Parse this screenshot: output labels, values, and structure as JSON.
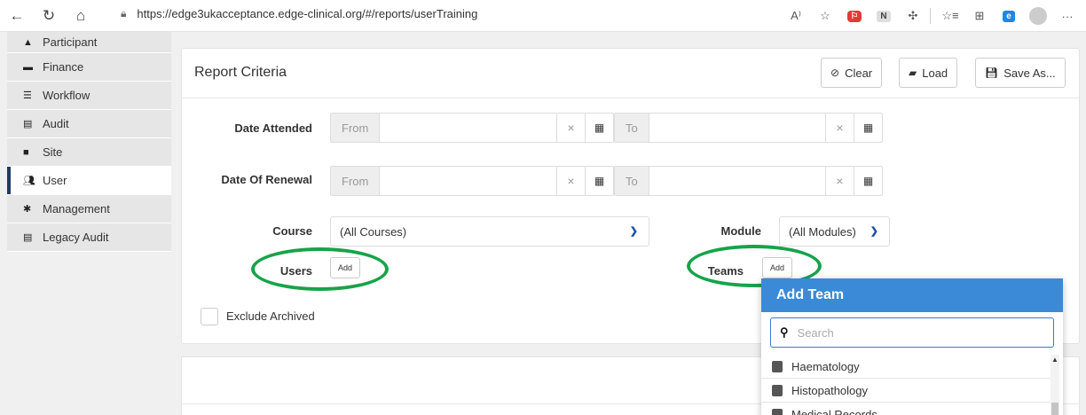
{
  "browser": {
    "url": "https://edge3ukacceptance.edge-clinical.org/#/reports/userTraining",
    "icons": [
      "back-icon",
      "refresh-icon",
      "home-icon",
      "lock-icon",
      "read-aloud-icon",
      "favorite-icon",
      "extension-red-icon",
      "extension-n-icon",
      "extensions-icon",
      "favorites-icon",
      "collections-icon",
      "edge-icon",
      "profile-icon",
      "more-icon"
    ],
    "badge_n": "N",
    "more": "···"
  },
  "sidebar": {
    "items": [
      {
        "label": "Participant",
        "icon": "person-icon"
      },
      {
        "label": "Finance",
        "icon": "wallet-icon"
      },
      {
        "label": "Workflow",
        "icon": "list-check-icon"
      },
      {
        "label": "Audit",
        "icon": "list-box-icon"
      },
      {
        "label": "Site",
        "icon": "h-square-icon"
      },
      {
        "label": "User",
        "icon": "users-icon"
      },
      {
        "label": "Management",
        "icon": "cog-icon"
      },
      {
        "label": "Legacy Audit",
        "icon": "list-box-icon"
      }
    ],
    "active": "User"
  },
  "report": {
    "title": "Report Criteria",
    "buttons": {
      "clear": "Clear",
      "load": "Load",
      "save_as": "Save As..."
    },
    "date_attended": {
      "label": "Date Attended",
      "from": "From",
      "to": "To"
    },
    "date_renewal": {
      "label": "Date Of Renewal",
      "from": "From",
      "to": "To"
    },
    "course": {
      "label": "Course",
      "value": "(All Courses)"
    },
    "module": {
      "label": "Module",
      "value": "(All Modules)"
    },
    "users": {
      "label": "Users",
      "add": "Add"
    },
    "teams": {
      "label": "Teams",
      "add": "Add"
    },
    "exclude_archived": {
      "label": "Exclude Archived",
      "checked": false
    }
  },
  "team_dropdown": {
    "title": "Add Team",
    "search_placeholder": "Search",
    "items": [
      "Haematology",
      "Histopathology",
      "Medical Records"
    ]
  },
  "colors": {
    "accent": "#3a8ad8",
    "highlight_ring": "#17a34a",
    "sidebar_active": "#1f3a64"
  }
}
